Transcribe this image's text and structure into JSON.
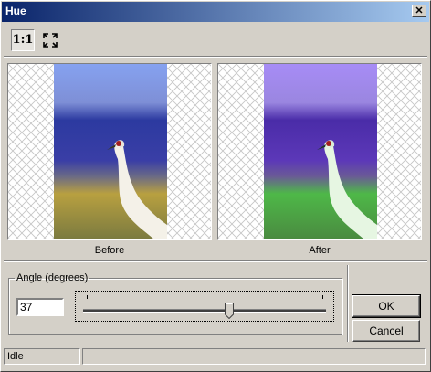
{
  "window": {
    "title": "Hue",
    "close_glyph": "✕",
    "close_icon": "close-icon"
  },
  "toolbar": {
    "actual_size_label": "1:1",
    "actual_size_icon": "actual-size-icon",
    "fit_icon": "fit-to-window-icon"
  },
  "preview": {
    "before_label": "Before",
    "after_label": "After",
    "checkerboard": "transparency-checkerboard"
  },
  "controls": {
    "group_label": "Angle (degrees)",
    "angle_value": "37",
    "angle_slider": {
      "min": -180,
      "max": 180,
      "value": 37
    }
  },
  "buttons": {
    "ok": "OK",
    "cancel": "Cancel"
  },
  "status": {
    "text": "Idle"
  },
  "colors": {
    "title_start": "#0a246a",
    "title_end": "#a6caf0",
    "face": "#d4d0c8"
  }
}
